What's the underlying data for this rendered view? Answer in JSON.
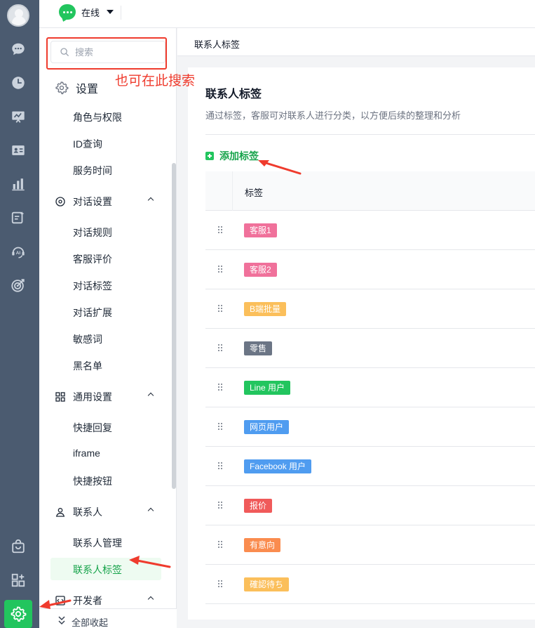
{
  "topbar": {
    "status_label": "在线",
    "status_color": "#22c55e"
  },
  "rail": {
    "icons": [
      "chat-icon",
      "history-icon",
      "monitor-icon",
      "contact-card-icon",
      "stats-icon",
      "ai-edit-icon",
      "ai-bot-icon",
      "target-icon",
      "shop-icon",
      "apps-icon",
      "settings-icon"
    ],
    "active": "settings-icon"
  },
  "sidebar": {
    "search_placeholder": "搜索",
    "settings_title": "设置",
    "items_top": [
      "角色与权限",
      "ID查询",
      "服务时间"
    ],
    "group_dialog": {
      "title": "对话设置",
      "items": [
        "对话规则",
        "客服评价",
        "对话标签",
        "对话扩展",
        "敏感词",
        "黑名单"
      ]
    },
    "group_general": {
      "title": "通用设置",
      "items": [
        "快捷回复",
        "iframe",
        "快捷按钮"
      ]
    },
    "group_contact": {
      "title": "联系人",
      "items": [
        "联系人管理",
        "联系人标签"
      ],
      "active": "联系人标签"
    },
    "group_dev": {
      "title": "开发者"
    },
    "collapse_label": "全部收起"
  },
  "annotation": {
    "text": "也可在此搜索",
    "color": "#ef3b2d"
  },
  "main": {
    "breadcrumb": "联系人标签",
    "title": "联系人标签",
    "description": "通过标签，客服可对联系人进行分类，以方便后续的整理和分析",
    "add_tag_label": "添加标签",
    "table_header": "标签",
    "tags": [
      {
        "label": "客服1",
        "color": "#f0719b"
      },
      {
        "label": "客服2",
        "color": "#f0719b"
      },
      {
        "label": "B端批量",
        "color": "#fbbf5b"
      },
      {
        "label": "零售",
        "color": "#6b7585"
      },
      {
        "label": "Line 用户",
        "color": "#22c55e"
      },
      {
        "label": "网页用户",
        "color": "#4f9cf0"
      },
      {
        "label": "Facebook 用户",
        "color": "#4f9cf0"
      },
      {
        "label": "报价",
        "color": "#f05a5a"
      },
      {
        "label": "有意向",
        "color": "#fa8c4f"
      },
      {
        "label": "確認待ち",
        "color": "#fbbf5b"
      }
    ]
  }
}
